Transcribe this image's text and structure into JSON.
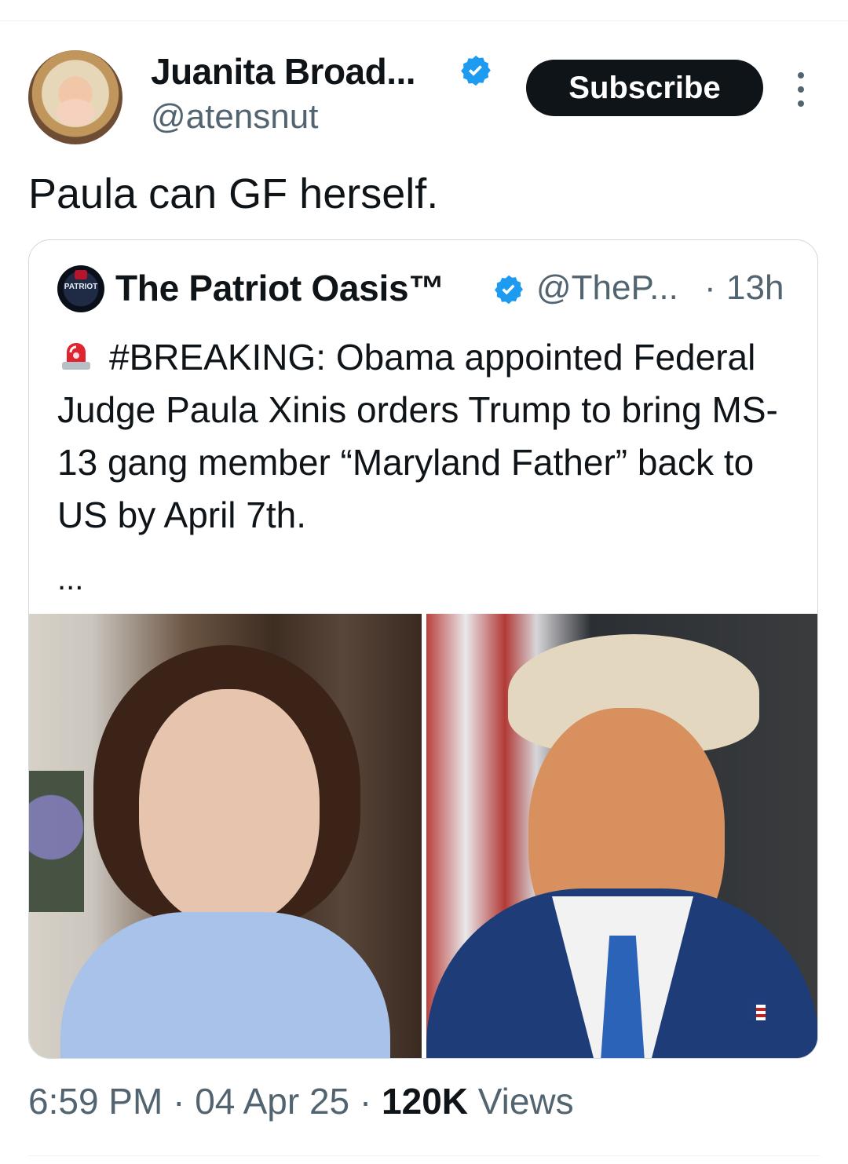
{
  "tweet": {
    "author": {
      "name": "Juanita Broad...",
      "handle": "@atensnut",
      "avatar_icon": "profile-photo",
      "verified": true,
      "verified_color": "#1d9bf0"
    },
    "actions": {
      "subscribe_label": "Subscribe",
      "more_icon": "vertical-ellipsis-icon"
    },
    "text": "Paula can GF herself.",
    "quote": {
      "author_name": "The Patriot Oasis™",
      "author_handle": "@TheP...",
      "separator": "·",
      "time": "13h",
      "avatar_text": "PATRIOT",
      "verified": true,
      "siren_icon": "rotating-light-emoji",
      "text": "#BREAKING: Obama appointed Federal Judge Paula Xinis orders Trump to bring MS-13 gang member “Maryland Father” back to US by April 7th.",
      "ellipsis": "...",
      "images": [
        "left-photo-woman",
        "right-photo-man"
      ]
    },
    "meta": {
      "time": "6:59 PM",
      "date": "04 Apr 25",
      "separator": "·",
      "views_count": "120K",
      "views_label": "Views"
    }
  },
  "colors": {
    "text_primary": "#0f1419",
    "text_secondary": "#536471",
    "border": "#cfd9de",
    "button_bg": "#0f1419"
  }
}
